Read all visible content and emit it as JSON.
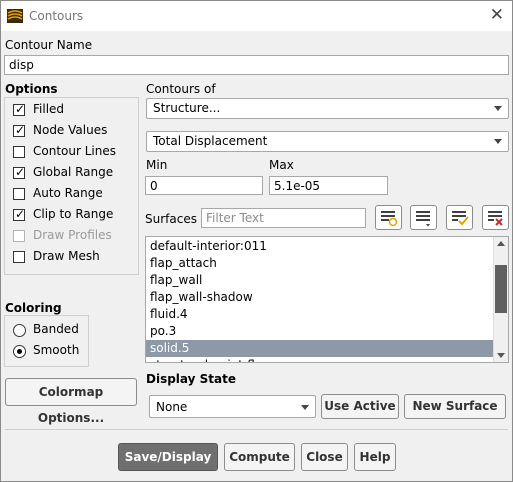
{
  "window": {
    "title": "Contours",
    "close_glyph": "✕"
  },
  "contour_name": {
    "label": "Contour Name",
    "value": "disp"
  },
  "options": {
    "title": "Options",
    "items": [
      {
        "label": "Filled",
        "checked": true,
        "disabled": false
      },
      {
        "label": "Node Values",
        "checked": true,
        "disabled": false
      },
      {
        "label": "Contour Lines",
        "checked": false,
        "disabled": false
      },
      {
        "label": "Global Range",
        "checked": true,
        "disabled": false
      },
      {
        "label": "Auto Range",
        "checked": false,
        "disabled": false
      },
      {
        "label": "Clip to Range",
        "checked": true,
        "disabled": false
      },
      {
        "label": "Draw Profiles",
        "checked": false,
        "disabled": true
      },
      {
        "label": "Draw Mesh",
        "checked": false,
        "disabled": false
      }
    ]
  },
  "coloring": {
    "title": "Coloring",
    "options": [
      {
        "label": "Banded",
        "selected": false
      },
      {
        "label": "Smooth",
        "selected": true
      }
    ]
  },
  "contours_of": {
    "label": "Contours of",
    "category": "Structure...",
    "quantity": "Total Displacement"
  },
  "range": {
    "min_label": "Min",
    "min_value": "0",
    "max_label": "Max",
    "max_value": "5.1e-05"
  },
  "surfaces": {
    "label": "Surfaces",
    "filter_placeholder": "Filter Text",
    "items": [
      "default-interior:011",
      "flap_attach",
      "flap_wall",
      "flap_wall-shadow",
      "fluid.4",
      "po.3",
      "solid.5",
      "structural-point-flap"
    ],
    "selected_index": 6,
    "tool_icons": [
      "select-all-icon",
      "filter-list-icon",
      "check-all-icon",
      "deselect-all-icon"
    ]
  },
  "colormap_button": "Colormap Options...",
  "display_state": {
    "label": "Display State",
    "value": "None",
    "use_active": "Use Active",
    "new_surface": "New Surface"
  },
  "footer": {
    "save_display": "Save/Display",
    "compute": "Compute",
    "close": "Close",
    "help": "Help"
  },
  "colors": {
    "selection": "#8e99a8",
    "primary_button": "#6f6f6f",
    "icon_orange": "#e8a000",
    "icon_blue": "#2a5fb5",
    "icon_red": "#c03030"
  }
}
